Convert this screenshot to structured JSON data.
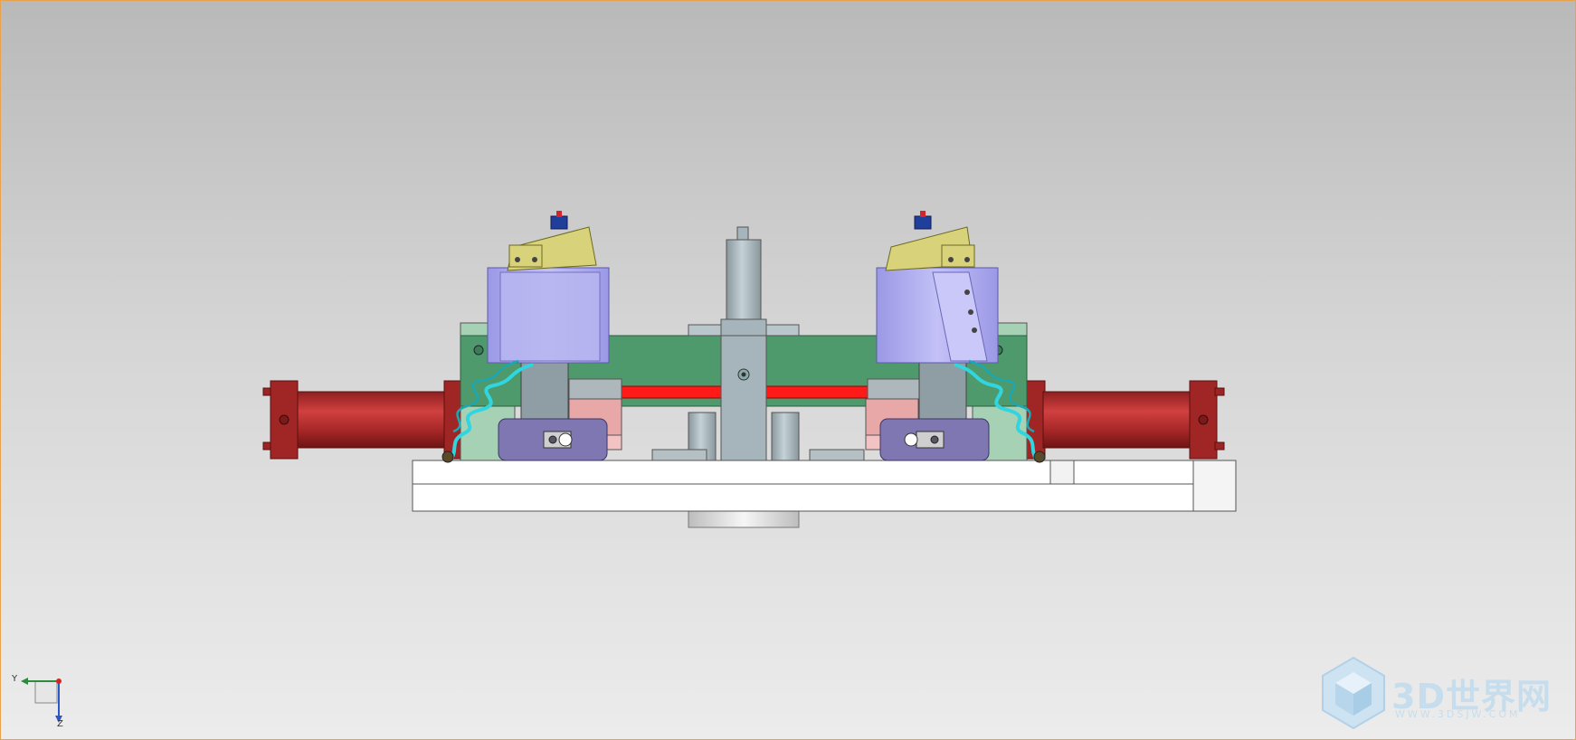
{
  "viewport": {
    "background_top": "#b9b9b9",
    "background_bottom": "#ececec",
    "border_color": "#e8a24c"
  },
  "triad": {
    "axis_y_label": "Y",
    "axis_z_label": "Z",
    "axis_y_color": "#2e8b3e",
    "axis_z_color": "#2b58c8",
    "axis_x_color": "#d2281e"
  },
  "watermark": {
    "title": "3D世界网",
    "url": "WWW.3DSJW.COM",
    "color": "#c6dded"
  },
  "colors": {
    "cylinder_red": "#b52b2b",
    "plate_green": "#4f9a6c",
    "clamp_lavender": "#a9a7ee",
    "cap_yellow": "#d8d37a",
    "hose_cyan": "#2fd6e0",
    "base_white": "#ffffff",
    "pink_block": "#e8a8a8",
    "purple_block": "#7f77b2",
    "steel_gray": "#a6b5bc",
    "bar_red": "#ff1a1a"
  }
}
